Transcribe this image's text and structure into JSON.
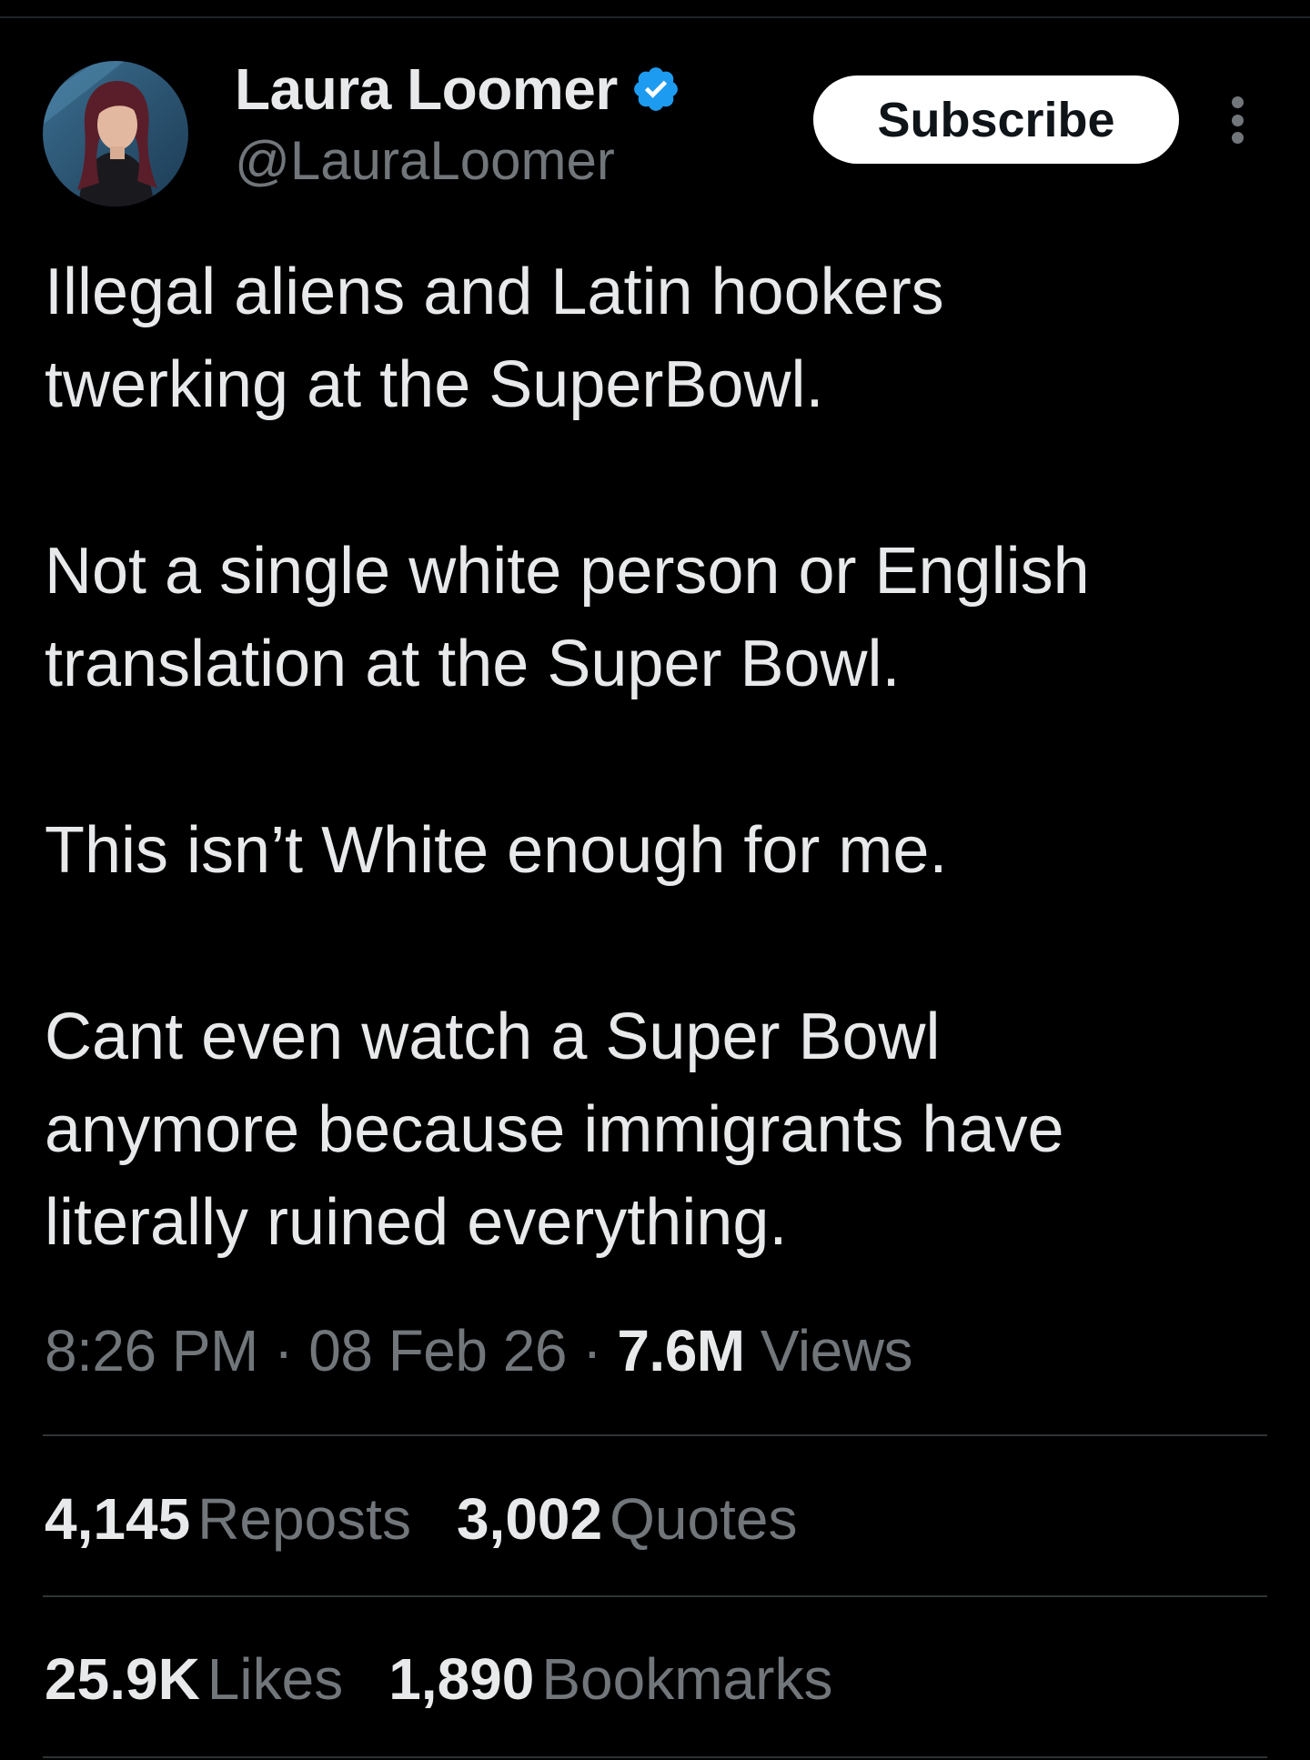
{
  "author": {
    "display_name": "Laura Loomer",
    "handle": "@LauraLoomer",
    "verified_color": "#1d9bf0"
  },
  "subscribe_label": "Subscribe",
  "tweet": {
    "paragraphs": [
      [
        "Illegal aliens and Latin hookers",
        "twerking at the SuperBowl."
      ],
      [
        "Not a single white person or English",
        "translation at the Super Bowl."
      ],
      [
        "This isn’t White enough for me."
      ],
      [
        "Cant even watch a Super Bowl",
        "anymore because immigrants have",
        "literally ruined everything."
      ]
    ]
  },
  "meta": {
    "time": "8:26 PM",
    "separator": "·",
    "date": "08 Feb 26",
    "views_count": "7.6M",
    "views_label": "Views"
  },
  "stats": {
    "reposts": {
      "count": "4,145",
      "label": "Reposts"
    },
    "quotes": {
      "count": "3,002",
      "label": "Quotes"
    },
    "likes": {
      "count": "25.9K",
      "label": "Likes"
    },
    "bookmarks": {
      "count": "1,890",
      "label": "Bookmarks"
    }
  },
  "colors": {
    "background": "#000000",
    "primary_text": "#e7e9ea",
    "secondary_text": "#71767b",
    "divider": "#2f3336",
    "accent": "#1d9bf0"
  }
}
